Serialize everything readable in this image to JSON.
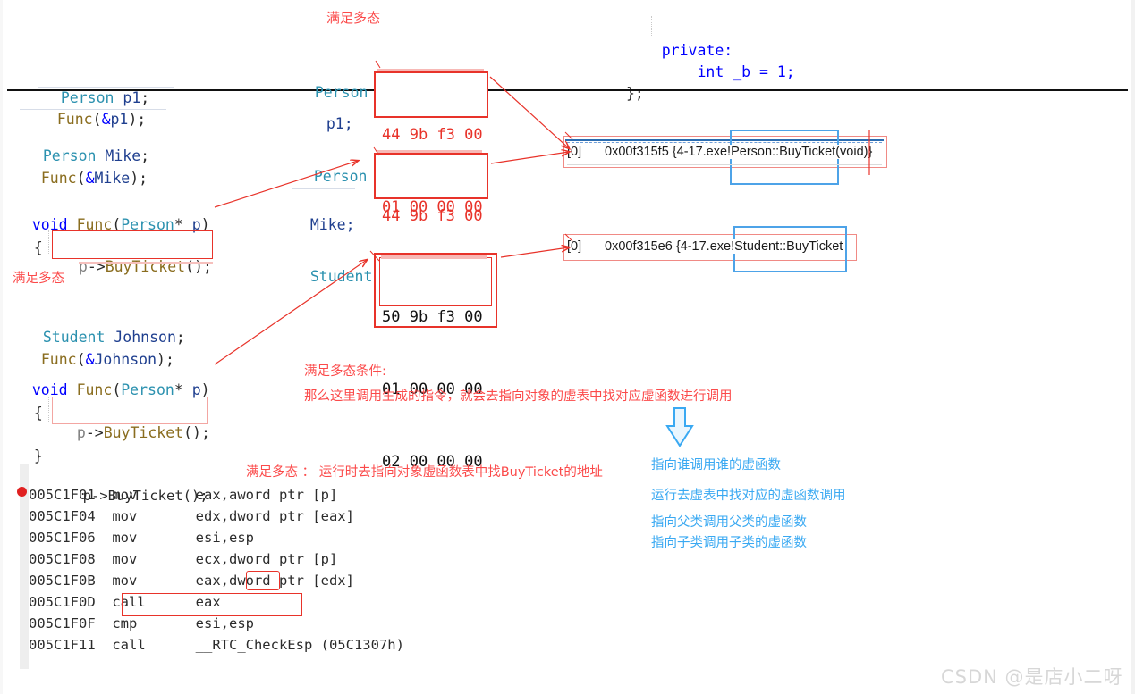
{
  "title_annotation": "满足多态",
  "top_snippet": {
    "lines": [
      {
        "indent": 4,
        "parts": [
          {
            "t": "private",
            "c": "kw"
          },
          {
            "t": ":",
            "c": "punct"
          }
        ]
      },
      {
        "indent": 8,
        "parts": [
          {
            "t": "int ",
            "c": "kw"
          },
          {
            "t": "_b ",
            "c": "var"
          },
          {
            "t": "= ",
            "c": "punct"
          },
          {
            "t": "1",
            "c": "var"
          },
          {
            "t": ";",
            "c": "punct"
          }
        ]
      },
      {
        "indent": 0,
        "parts": [
          {
            "t": "};",
            "c": "punct"
          }
        ]
      }
    ],
    "raw": [
      "    private:",
      "        int _b = 1;",
      "};"
    ]
  },
  "code_blocks": {
    "block1": [
      "Person p1;",
      "Func(&p1);"
    ],
    "block2": [
      "Person Mike;",
      "Func(&Mike);"
    ],
    "block3": [
      "void Func(Person* p)",
      "{",
      "    p->BuyTicket();",
      "}"
    ],
    "block4": [
      "Student Johnson;",
      "Func(&Johnson);"
    ],
    "block5": [
      "void Func(Person* p)",
      "{",
      "    p->BuyTicket();",
      "}"
    ]
  },
  "object_labels": [
    {
      "type": "Person",
      "name": "p1;"
    },
    {
      "type": "Person",
      "name": "Mike;"
    },
    {
      "type": "Student",
      "name": ""
    }
  ],
  "memory_boxes": [
    {
      "id": "p1-memory",
      "rows": [
        "44 9b f3 00",
        "01 00 00 00"
      ],
      "color": "#e8332a"
    },
    {
      "id": "mike-memory",
      "rows": [
        "44 9b f3 00",
        "01 00 00 00"
      ],
      "color": "#e8332a"
    },
    {
      "id": "johnson-memory",
      "rows": [
        "50 9b f3 00",
        "01 00 00 00",
        "02 00 00 00"
      ],
      "color": "#111111"
    }
  ],
  "watch_rows": [
    {
      "index": "[0]",
      "value": "0x00f315f5 {4-17.exe!",
      "symbol": "Person::BuyTicket",
      "suffix": "(void)}"
    },
    {
      "index": "[0]",
      "value": "0x00f315e6 {4-17.exe!",
      "symbol": "Student::BuyTicket",
      "suffix": ""
    }
  ],
  "annotations": {
    "满足多态_top": "满足多态",
    "满足多态_mid": "满足多态",
    "condition_title": "满足多态条件:",
    "condition_body": "那么这里调用生成的指令，就会去指向对象的虚表中找对应虚函数进行调用",
    "runtime_note": "满足多态 ： 运行时去指向对象虚函数表中找BuyTicket的地址",
    "blue_notes": [
      "指向谁调用谁的虚函数",
      "运行去虚表中找对应的虚函数调用",
      "指向父类调用父类的虚函数",
      "指向子类调用子类的虚函数"
    ]
  },
  "assembly": {
    "source_line": "p->BuyTicket();",
    "rows": [
      {
        "addr": "005C1F01",
        "op": "mov",
        "operands": "eax,aword ptr [p]",
        "breakpoint": true
      },
      {
        "addr": "005C1F04",
        "op": "mov",
        "operands": "edx,dword ptr [eax]",
        "breakpoint": false
      },
      {
        "addr": "005C1F06",
        "op": "mov",
        "operands": "esi,esp",
        "breakpoint": false
      },
      {
        "addr": "005C1F08",
        "op": "mov",
        "operands": "ecx,dword ptr [p]",
        "breakpoint": false
      },
      {
        "addr": "005C1F0B",
        "op": "mov",
        "operands": "eax,dword ptr [edx]",
        "breakpoint": false
      },
      {
        "addr": "005C1F0D",
        "op": "call",
        "operands": "eax",
        "breakpoint": false
      },
      {
        "addr": "005C1F0F",
        "op": "cmp",
        "operands": "esi,esp",
        "breakpoint": false
      },
      {
        "addr": "005C1F11",
        "op": "call",
        "operands": "__RTC_CheckEsp (05C1307h)",
        "breakpoint": false
      }
    ]
  },
  "watermark": "CSDN @是店小二呀",
  "colors": {
    "annotation_red": "#fb4a4a",
    "annotation_blue": "#3aa9f2",
    "hex_red": "#e8332a",
    "keyword_blue": "#0000ff",
    "type_cyan": "#2b91af",
    "function_gold": "#8a6d1f",
    "breakpoint_red": "#e02020"
  }
}
